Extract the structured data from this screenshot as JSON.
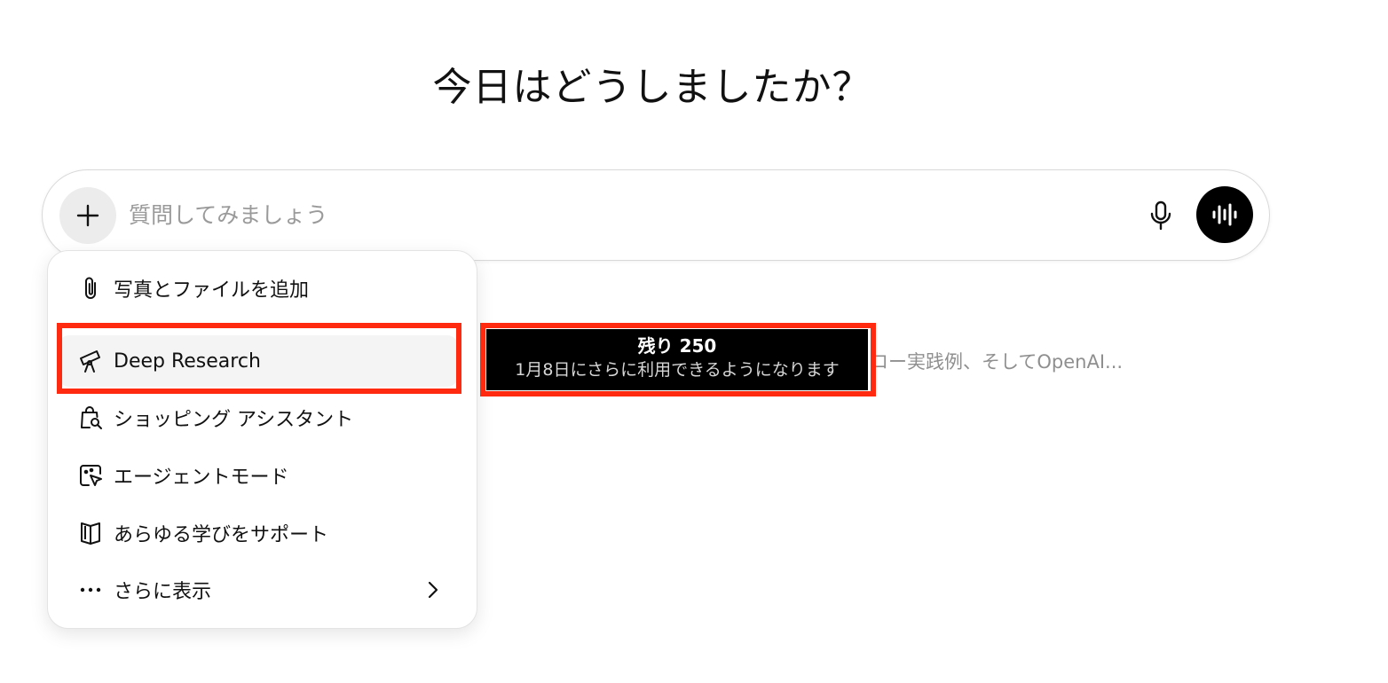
{
  "heading": "今日はどうしましたか？",
  "composer": {
    "placeholder": "質問してみましょう",
    "plus_icon": "plus-icon",
    "mic_icon": "microphone-icon",
    "voice_icon": "voice-wave-icon"
  },
  "background_text": "ロー実践例、そしてOpenAI...",
  "menu": {
    "items": [
      {
        "label": "写真とファイルを追加",
        "icon": "paperclip-icon"
      },
      {
        "label": "Deep Research",
        "icon": "telescope-icon"
      },
      {
        "label": "ショッピング アシスタント",
        "icon": "shopping-bag-search-icon"
      },
      {
        "label": "エージェントモード",
        "icon": "agent-cursor-icon"
      },
      {
        "label": "あらゆる学びをサポート",
        "icon": "book-icon"
      },
      {
        "label": "さらに表示",
        "icon": "ellipsis-icon"
      }
    ],
    "more_chevron_icon": "chevron-right-icon"
  },
  "tooltip": {
    "title": "残り 250",
    "subtitle": "1月8日にさらに利用できるようになります"
  },
  "colors": {
    "highlight": "#ff2a0f",
    "voice_button": "#000000",
    "placeholder": "#9a9a9a"
  }
}
